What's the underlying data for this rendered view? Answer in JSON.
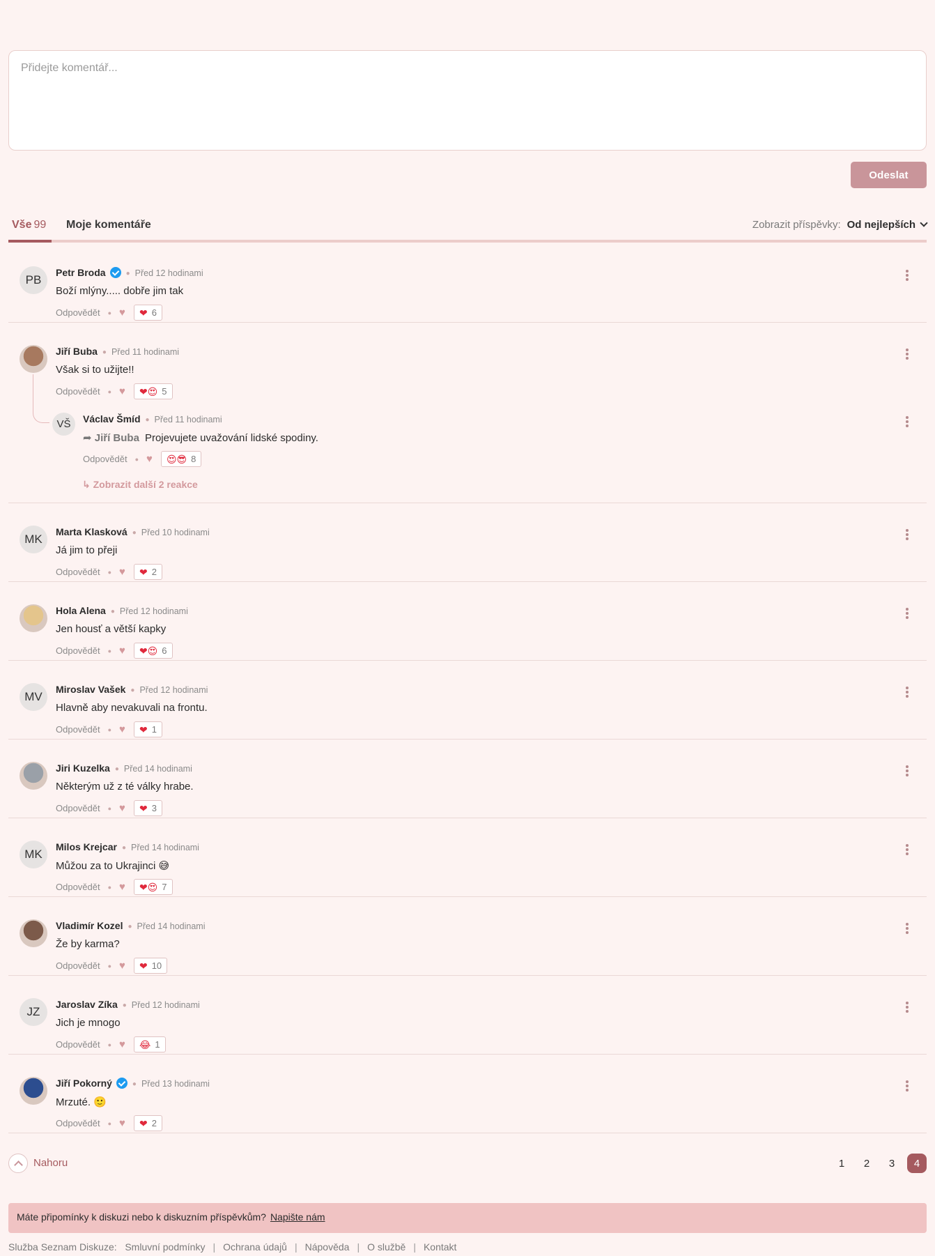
{
  "composer": {
    "placeholder": "Přidejte komentář...",
    "send_label": "Odeslat"
  },
  "tabs": {
    "all_label": "Vše",
    "all_count": "99",
    "mine_label": "Moje komentáře",
    "sort_label": "Zobrazit příspěvky:",
    "sort_value": "Od nejlepších"
  },
  "comments": [
    {
      "initials": "PB",
      "name": "Petr Broda",
      "verified": true,
      "time": "Před 12 hodinami",
      "text": "Boží mlýny..... dobře jim tak",
      "reply": "Odpovědět",
      "reaction_emoji": "❤",
      "reaction_count": "6"
    },
    {
      "initials": "",
      "name": "Jiří Buba",
      "verified": false,
      "time": "Před 11 hodinami",
      "text": "Však si to užijte!!",
      "reply": "Odpovědět",
      "reaction_emoji": "❤😍",
      "reaction_count": "5",
      "child": {
        "initials": "VŠ",
        "name": "Václav Šmíd",
        "time": "Před 11 hodinami",
        "reply_to": "Jiří Buba",
        "text": "Projevujete uvažování lidské spodiny.",
        "reply": "Odpovědět",
        "reaction_emoji": "😍😎",
        "reaction_count": "8"
      },
      "more_replies": "Zobrazit další 2 reakce"
    },
    {
      "initials": "MK",
      "name": "Marta Klasková",
      "verified": false,
      "time": "Před 10 hodinami",
      "text": "Já jim to přeji",
      "reply": "Odpovědět",
      "reaction_emoji": "❤",
      "reaction_count": "2"
    },
    {
      "initials": "",
      "name": "Hola Alena",
      "verified": false,
      "time": "Před 12 hodinami",
      "text": "Jen housť a větší kapky",
      "reply": "Odpovědět",
      "reaction_emoji": "❤😍",
      "reaction_count": "6"
    },
    {
      "initials": "MV",
      "name": "Miroslav Vašek",
      "verified": false,
      "time": "Před 12 hodinami",
      "text": "Hlavně aby nevakuvali na frontu.",
      "reply": "Odpovědět",
      "reaction_emoji": "❤",
      "reaction_count": "1"
    },
    {
      "initials": "",
      "name": "Jiri Kuzelka",
      "verified": false,
      "time": "Před 14 hodinami",
      "text": "Některým už z té války hrabe.",
      "reply": "Odpovědět",
      "reaction_emoji": "❤",
      "reaction_count": "3"
    },
    {
      "initials": "MK",
      "name": "Milos Krejcar",
      "verified": false,
      "time": "Před 14 hodinami",
      "text": "Můžou za to Ukrajinci 😅",
      "reply": "Odpovědět",
      "reaction_emoji": "❤😍",
      "reaction_count": "7"
    },
    {
      "initials": "",
      "name": "Vladimír Kozel",
      "verified": false,
      "time": "Před 14 hodinami",
      "text": "Že by karma?",
      "reply": "Odpovědět",
      "reaction_emoji": "❤",
      "reaction_count": "10"
    },
    {
      "initials": "JZ",
      "name": "Jaroslav Zíka",
      "verified": false,
      "time": "Před 12 hodinami",
      "text": "Jich je mnogo",
      "reply": "Odpovědět",
      "reaction_emoji": "😂",
      "reaction_count": "1"
    },
    {
      "initials": "",
      "name": "Jiří Pokorný",
      "verified": true,
      "time": "Před 13 hodinami",
      "text": "Mrzuté. 🙂",
      "reply": "Odpovědět",
      "reaction_emoji": "❤",
      "reaction_count": "2"
    }
  ],
  "pager": {
    "up_label": "Nahoru",
    "pages": [
      "1",
      "2",
      "3",
      "4"
    ],
    "active_page": "4"
  },
  "feedback": {
    "text": "Máte připomínky k diskuzi nebo k diskuzním příspěvkům?",
    "link": "Napište nám"
  },
  "footer": {
    "service": "Služba Seznam Diskuze:",
    "links": [
      "Smluvní podmínky",
      "Ochrana údajů",
      "Nápověda",
      "O službě",
      "Kontakt"
    ]
  },
  "colors": {
    "accent": "#a55a5f",
    "background": "#fdf3f2",
    "send_button": "#c9959a",
    "feedback_bar": "#f0c3c3",
    "verified": "#1d9bf0"
  }
}
